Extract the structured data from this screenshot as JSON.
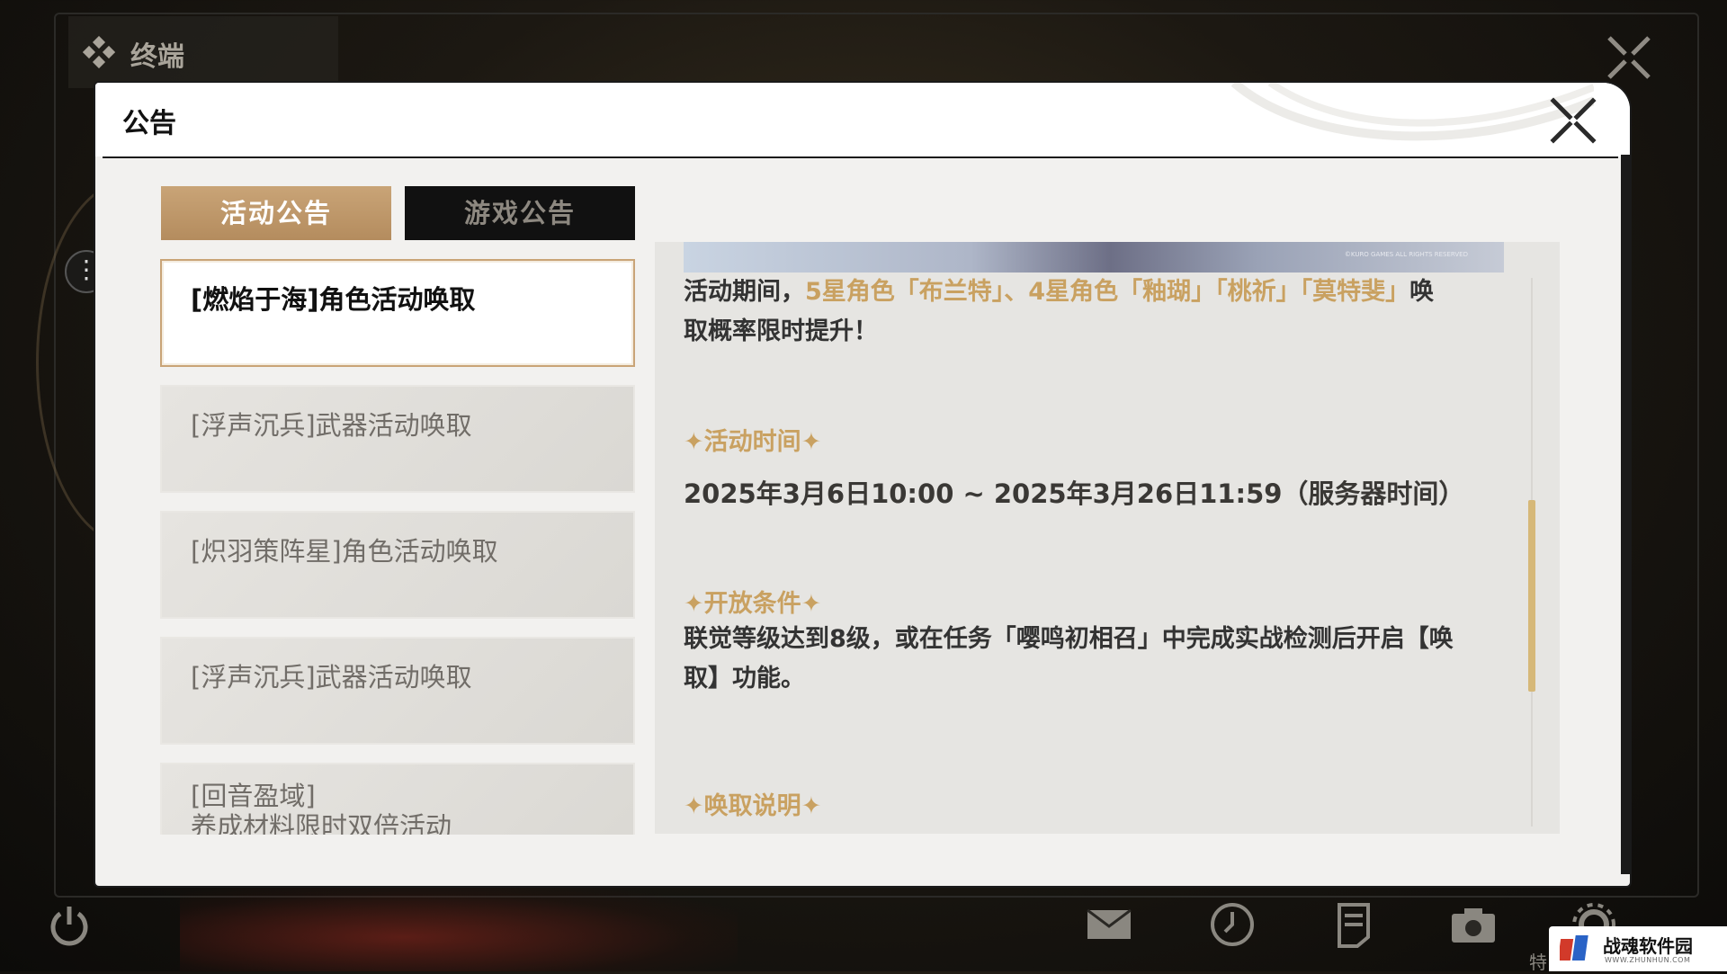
{
  "background": {
    "window_title": "终端"
  },
  "dialog": {
    "title": "公告"
  },
  "tabs": [
    {
      "label": "活动公告",
      "active": true
    },
    {
      "label": "游戏公告",
      "active": false
    }
  ],
  "announcements": [
    {
      "label": "[燃焰于海]角色活动唤取",
      "active": true
    },
    {
      "label": "[浮声沉兵]武器活动唤取",
      "active": false
    },
    {
      "label": "[炽羽策阵星]角色活动唤取",
      "active": false
    },
    {
      "label": "[浮声沉兵]武器活动唤取",
      "active": false
    },
    {
      "label_line1": "[回音盈域]",
      "label_line2": "养成材料限时双倍活动",
      "active": false
    }
  ],
  "content": {
    "banner_watermark": "©KURO GAMES ALL RIGHTS RESERVED",
    "intro_prefix": "活动期间，",
    "intro_highlight": "5星角色「布兰特」、4星角色「釉瑚」「桃祈」「莫特斐」",
    "intro_suffix_line1": "唤",
    "intro_line2": "取概率限时提升！",
    "section_time_heading": "✦活动时间✦",
    "section_time_value": "2025年3月6日10:00 ~ 2025年3月26日11:59（服务器时间）",
    "section_condition_heading": "✦开放条件✦",
    "section_condition_line1": "联觉等级达到8级，或在任务「嘤鸣初相召」中完成实战检测后开启【唤",
    "section_condition_line2": "取】功能。",
    "section_rules_heading": "✦唤取说明✦"
  },
  "bottom_bar": {
    "icons": [
      "power-icon",
      "mail-icon",
      "clock-icon",
      "notes-icon",
      "camera-icon",
      "settings-icon"
    ],
    "partial_label": "特"
  },
  "watermark": {
    "text": "战魂软件园",
    "sub": "WWW.ZHUNHUN.COM"
  },
  "colors": {
    "accent_gold": "#c9a161",
    "tab_active": "#b48c5e",
    "tab_inactive": "#111111"
  }
}
